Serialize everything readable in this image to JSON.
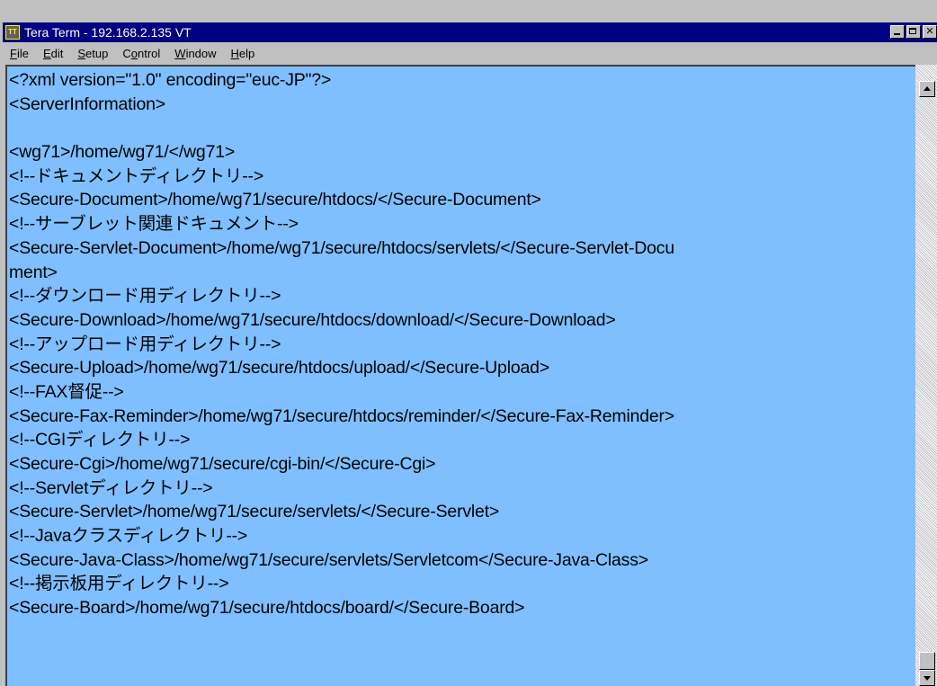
{
  "window": {
    "title": "Tera Term - 192.168.2.135 VT",
    "app_icon": "tera-term-icon",
    "colors": {
      "titlebar": "#000080",
      "terminal_bg": "#7fbfff",
      "chrome": "#c0c0c0"
    }
  },
  "menu": {
    "file": {
      "mnemonic": "F",
      "rest": "ile"
    },
    "edit": {
      "mnemonic": "E",
      "rest": "dit"
    },
    "setup": {
      "mnemonic": "S",
      "rest": "etup"
    },
    "control": {
      "pre": "C",
      "mnemonic": "o",
      "rest": "ntrol"
    },
    "window": {
      "mnemonic": "W",
      "rest": "indow"
    },
    "help": {
      "mnemonic": "H",
      "rest": "elp"
    }
  },
  "terminal": {
    "lines": [
      "<?xml version=\"1.0\" encoding=\"euc-JP\"?>",
      "<ServerInformation>",
      "",
      "<wg71>/home/wg71/</wg71>",
      "<!--ドキュメントディレクトリ-->",
      "<Secure-Document>/home/wg71/secure/htdocs/</Secure-Document>",
      "<!--サーブレット関連ドキュメント-->",
      "<Secure-Servlet-Document>/home/wg71/secure/htdocs/servlets/</Secure-Servlet-Docu",
      "ment>",
      "<!--ダウンロード用ディレクトリ-->",
      "<Secure-Download>/home/wg71/secure/htdocs/download/</Secure-Download>",
      "<!--アップロード用ディレクトリ-->",
      "<Secure-Upload>/home/wg71/secure/htdocs/upload/</Secure-Upload>",
      "<!--FAX督促-->",
      "<Secure-Fax-Reminder>/home/wg71/secure/htdocs/reminder/</Secure-Fax-Reminder>",
      "<!--CGIディレクトリ-->",
      "<Secure-Cgi>/home/wg71/secure/cgi-bin/</Secure-Cgi>",
      "<!--Servletディレクトリ-->",
      "<Secure-Servlet>/home/wg71/secure/servlets/</Secure-Servlet>",
      "<!--Javaクラスディレクトリ-->",
      "<Secure-Java-Class>/home/wg71/secure/servlets/Servletcom</Secure-Java-Class>",
      "<!--掲示板用ディレクトリ-->",
      "<Secure-Board>/home/wg71/secure/htdocs/board/</Secure-Board>"
    ]
  }
}
